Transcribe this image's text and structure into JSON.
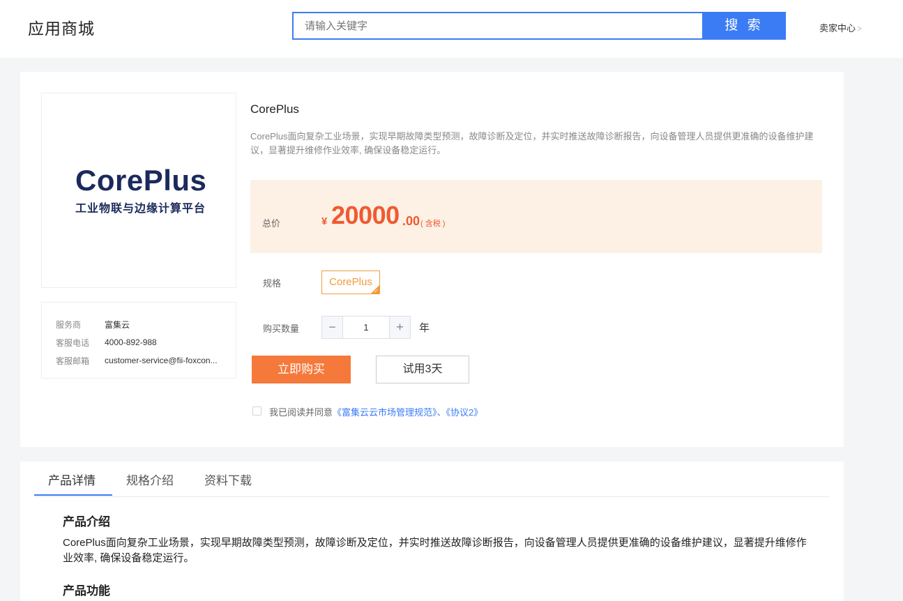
{
  "header": {
    "app_title": "应用商城",
    "search_placeholder": "请输入关键字",
    "search_button": "搜 索",
    "seller_center": "卖家中心"
  },
  "product": {
    "logo_text": "CorePlus",
    "logo_subtitle": "工业物联与边缘计算平台",
    "name": "CorePlus",
    "description": "CorePlus面向复杂工业场景，实现早期故障类型预测，故障诊断及定位，并实时推送故障诊断报告，向设备管理人员提供更准确的设备维护建议，显著提升维修作业效率, 确保设备稳定运行。"
  },
  "vendor": {
    "rows": [
      {
        "label": "服务商",
        "value": "富集云"
      },
      {
        "label": "客服电话",
        "value": "4000-892-988"
      },
      {
        "label": "客服邮箱",
        "value": "customer-service@fii-foxcon..."
      }
    ]
  },
  "price": {
    "label": "总价",
    "currency": "¥",
    "integer": "20000",
    "decimal": ".00",
    "tax_note": "( 含税 )"
  },
  "spec": {
    "label": "规格",
    "selected": "CorePlus"
  },
  "quantity": {
    "label": "购买数量",
    "value": "1",
    "unit": "年",
    "minus": "−",
    "plus": "+"
  },
  "actions": {
    "buy": "立即购买",
    "trial": "试用3天"
  },
  "agreement": {
    "prefix": "我已阅读并同意",
    "link1": "《富集云云市场管理规范》",
    "separator": "、",
    "link2": "《协议2》",
    "checked": false
  },
  "detail": {
    "tabs": [
      "产品详情",
      "规格介绍",
      "资料下载"
    ],
    "active_tab": 0,
    "intro_title": "产品介绍",
    "intro_body": "CorePlus面向复杂工业场景，实现早期故障类型预测，故障诊断及定位，并实时推送故障诊断报告，向设备管理人员提供更准确的设备维护建议，显著提升维修作业效率, 确保设备稳定运行。",
    "features_title": "产品功能"
  },
  "colors": {
    "primary": "#3b7cf4",
    "price": "#ef5a31",
    "buy_button": "#f5793b",
    "spec_accent": "#f29a3a",
    "price_panel_bg": "#fdf0e4"
  }
}
